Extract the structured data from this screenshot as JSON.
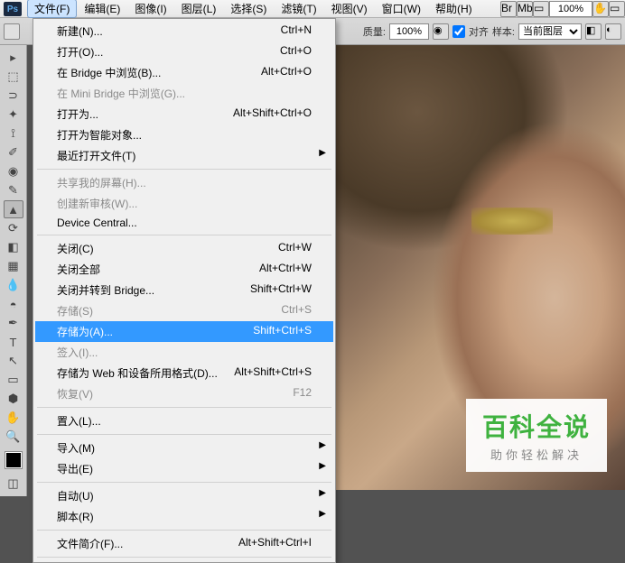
{
  "app_logo": "Ps",
  "menubar": [
    {
      "label": "文件(F)",
      "active": true
    },
    {
      "label": "编辑(E)"
    },
    {
      "label": "图像(I)"
    },
    {
      "label": "图层(L)"
    },
    {
      "label": "选择(S)"
    },
    {
      "label": "滤镜(T)"
    },
    {
      "label": "视图(V)"
    },
    {
      "label": "窗口(W)"
    },
    {
      "label": "帮助(H)"
    }
  ],
  "top_options": {
    "zoom_value": "100%",
    "quality_label": "质量:",
    "quality_value": "100%",
    "align_label": "对齐",
    "sample_label": "样本:",
    "sample_value": "当前图层"
  },
  "dropdown": [
    {
      "label": "新建(N)...",
      "shortcut": "Ctrl+N"
    },
    {
      "label": "打开(O)...",
      "shortcut": "Ctrl+O"
    },
    {
      "label": "在 Bridge 中浏览(B)...",
      "shortcut": "Alt+Ctrl+O"
    },
    {
      "label": "在 Mini Bridge 中浏览(G)...",
      "disabled": true
    },
    {
      "label": "打开为...",
      "shortcut": "Alt+Shift+Ctrl+O"
    },
    {
      "label": "打开为智能对象..."
    },
    {
      "label": "最近打开文件(T)",
      "submenu": true
    },
    {
      "sep": true
    },
    {
      "label": "共享我的屏幕(H)...",
      "disabled": true
    },
    {
      "label": "创建新审核(W)...",
      "disabled": true
    },
    {
      "label": "Device Central..."
    },
    {
      "sep": true
    },
    {
      "label": "关闭(C)",
      "shortcut": "Ctrl+W"
    },
    {
      "label": "关闭全部",
      "shortcut": "Alt+Ctrl+W"
    },
    {
      "label": "关闭并转到 Bridge...",
      "shortcut": "Shift+Ctrl+W"
    },
    {
      "label": "存储(S)",
      "shortcut": "Ctrl+S",
      "disabled": true
    },
    {
      "label": "存储为(A)...",
      "shortcut": "Shift+Ctrl+S",
      "highlight": true
    },
    {
      "label": "签入(I)...",
      "disabled": true
    },
    {
      "label": "存储为 Web 和设备所用格式(D)...",
      "shortcut": "Alt+Shift+Ctrl+S"
    },
    {
      "label": "恢复(V)",
      "shortcut": "F12",
      "disabled": true
    },
    {
      "sep": true
    },
    {
      "label": "置入(L)..."
    },
    {
      "sep": true
    },
    {
      "label": "导入(M)",
      "submenu": true
    },
    {
      "label": "导出(E)",
      "submenu": true
    },
    {
      "sep": true
    },
    {
      "label": "自动(U)",
      "submenu": true
    },
    {
      "label": "脚本(R)",
      "submenu": true
    },
    {
      "sep": true
    },
    {
      "label": "文件简介(F)...",
      "shortcut": "Alt+Shift+Ctrl+I"
    },
    {
      "sep": true
    }
  ],
  "tools": [
    "▭",
    "⬚",
    "✥",
    "✂",
    "✎",
    "↯",
    "✦",
    "⌖",
    "◉",
    "⟐",
    "△",
    "◧",
    "✐",
    "◓",
    "⬛",
    "⬒",
    "◆",
    "◯",
    "T",
    "⬡",
    "↗",
    "✋",
    "⊕",
    "◐",
    "⬢",
    "◪"
  ],
  "watermark": {
    "big": "百科全说",
    "small": "助你轻松解决"
  }
}
